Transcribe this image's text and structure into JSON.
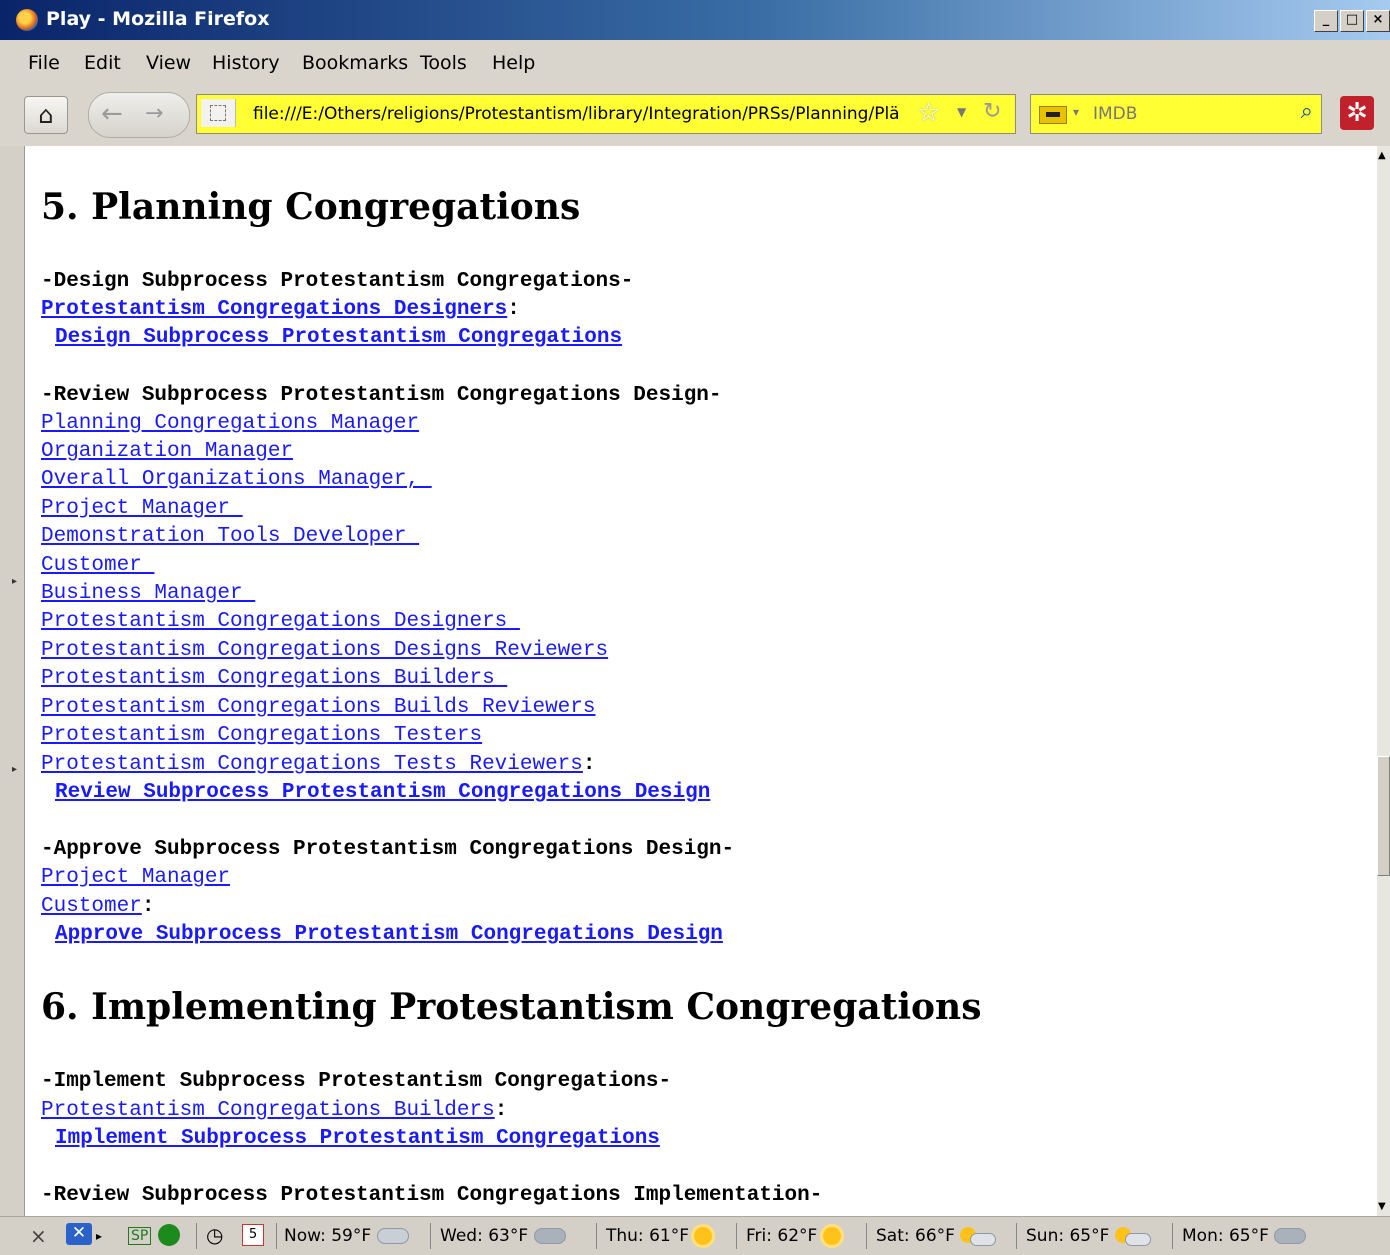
{
  "window": {
    "title": "Play - Mozilla Firefox",
    "buttons": [
      "_",
      "□",
      "×"
    ]
  },
  "menu": [
    "File",
    "Edit",
    "View",
    "History",
    "Bookmarks",
    "Tools",
    "Help"
  ],
  "toolbar": {
    "url": "file:///E:/Others/religions/Protestantism/library/Integration/PRSs/Planning/Plä",
    "search_placeholder": "IMDB"
  },
  "content": {
    "sec5": "5. Planning Congregations",
    "d_head": "-Design Subprocess Protestantism Congregations-",
    "d_link": "Protestantism Congregations Designers",
    "d_colon": ":",
    "d_action": "Design Subprocess Protestantism Congregations",
    "r_head": "-Review Subprocess Protestantism Congregations Design-",
    "r_links": [
      "Planning Congregations Manager",
      "Organization Manager",
      "Overall Organizations Manager, ",
      "Project Manager ",
      "Demonstration Tools Developer ",
      "Customer ",
      "Business Manager ",
      "Protestantism Congregations Designers ",
      "Protestantism Congregations Designs Reviewers",
      "Protestantism Congregations Builders ",
      "Protestantism Congregations Builds Reviewers",
      "Protestantism Congregations Testers",
      "Protestantism Congregations Tests Reviewers"
    ],
    "r_colon": ":",
    "r_action": "Review Subprocess Protestantism Congregations Design",
    "a_head": "-Approve Subprocess Protestantism Congregations Design-",
    "a_links": [
      "Project Manager",
      "Customer"
    ],
    "a_colon": ":",
    "a_action": "Approve Subprocess Protestantism Congregations Design",
    "sec6": "6. Implementing Protestantism Congregations",
    "i_head": "-Implement Subprocess Protestantism Congregations-",
    "i_link": "Protestantism Congregations Builders",
    "i_colon": ":",
    "i_action": "Implement Subprocess Protestantism Congregations",
    "ri_head": "-Review Subprocess Protestantism Congregations Implementation-"
  },
  "status": {
    "sp": "SP",
    "cal": "5",
    "now": "Now: 59°F",
    "wed": "Wed: 63°F",
    "thu": "Thu: 61°F",
    "fri": "Fri: 62°F",
    "sat": "Sat: 66°F",
    "sun": "Sun: 65°F",
    "mon": "Mon: 65°F"
  }
}
